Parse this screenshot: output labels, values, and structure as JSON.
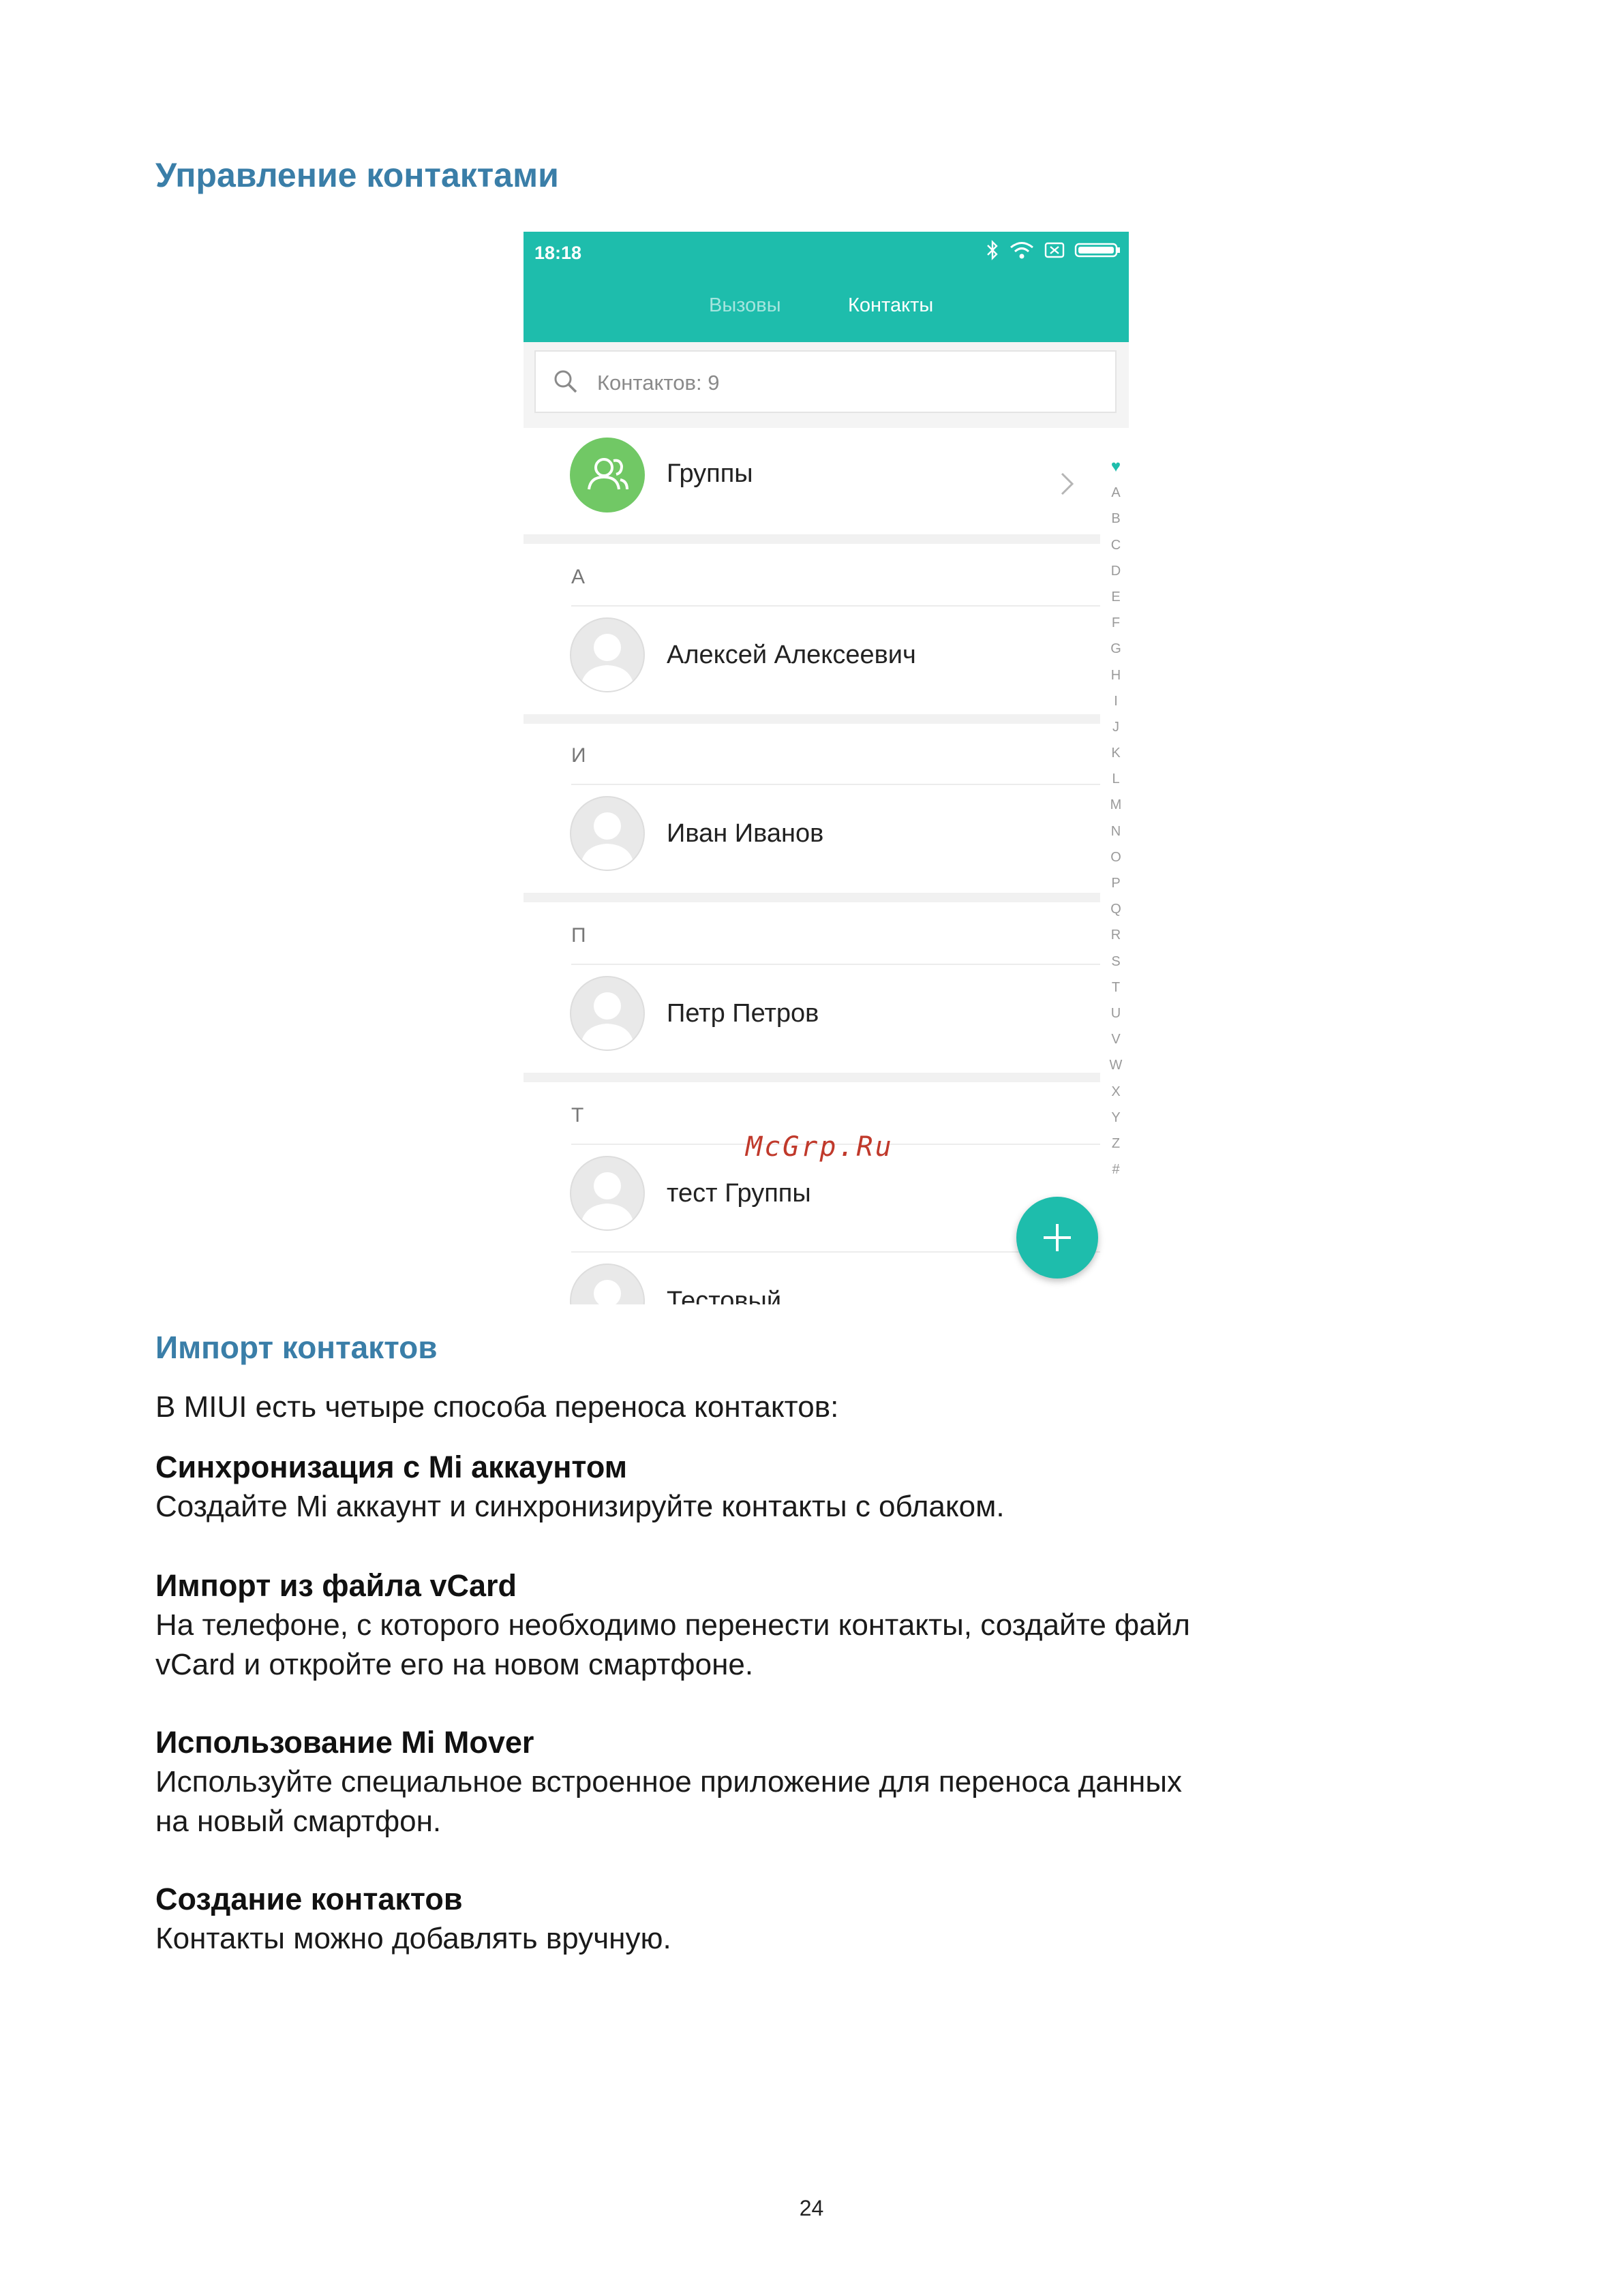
{
  "document": {
    "title": "Управление контактами",
    "import_heading": "Импорт контактов",
    "intro": "В MIUI есть четыре способа переноса контактов:",
    "sections": [
      {
        "heading": "Синхронизация с Mi аккаунтом",
        "lines": [
          "Создайте Mi аккаунт и синхронизируйте контакты с облаком."
        ]
      },
      {
        "heading": "Импорт из файла vCard",
        "lines": [
          "На телефоне, с которого необходимо перенести контакты, создайте файл",
          "vCard и откройте его на новом смартфоне."
        ]
      },
      {
        "heading": "Использование Mi Mover",
        "lines": [
          "Используйте специальное встроенное приложение для переноса данных",
          "на новый смартфон."
        ]
      },
      {
        "heading": "Создание контактов",
        "lines": [
          "Контакты можно добавлять вручную."
        ]
      }
    ],
    "page_number": "24",
    "watermark": "McGrp.Ru"
  },
  "phone": {
    "status_time": "18:18",
    "tabs": [
      "Вызовы",
      "Контакты"
    ],
    "search_placeholder": "Контактов: 9",
    "groups_label": "Группы",
    "contacts": [
      {
        "letter": "А",
        "name": "Алексей Алексеевич"
      },
      {
        "letter": "И",
        "name": "Иван Иванов"
      },
      {
        "letter": "П",
        "name": "Петр Петров"
      },
      {
        "letter": "Т",
        "name": "тест Группы"
      }
    ],
    "partial_contact": "Тестовый",
    "alphabet": [
      "A",
      "B",
      "C",
      "D",
      "E",
      "F",
      "G",
      "H",
      "I",
      "J",
      "K",
      "L",
      "M",
      "N",
      "O",
      "P",
      "Q",
      "R",
      "S",
      "T",
      "U",
      "V",
      "W",
      "X",
      "Y",
      "Z",
      "#"
    ],
    "colors": {
      "accent": "#1ebdac",
      "groups_avatar": "#71c865",
      "heading": "#3a7ea8"
    }
  }
}
